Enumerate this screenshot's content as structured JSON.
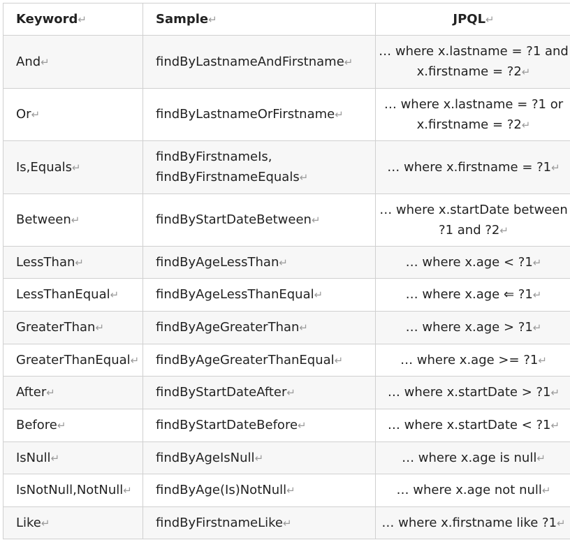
{
  "table": {
    "headers": {
      "keyword": "Keyword",
      "sample": "Sample",
      "jpql": "JPQL"
    },
    "paragraph_mark": "↵",
    "rows": [
      {
        "keyword": "And",
        "sample": "findByLastnameAndFirstname",
        "sample2": "",
        "jpql": "… where x.lastname = ?1 and x.firstname = ?2"
      },
      {
        "keyword": "Or",
        "sample": "findByLastnameOrFirstname",
        "sample2": "",
        "jpql": "… where x.lastname = ?1 or x.firstname = ?2"
      },
      {
        "keyword": "Is,Equals",
        "sample": "findByFirstnameIs,",
        "sample2": "findByFirstnameEquals",
        "jpql": "… where x.firstname = ?1"
      },
      {
        "keyword": "Between",
        "sample": "findByStartDateBetween",
        "sample2": "",
        "jpql": "… where x.startDate between ?1 and ?2"
      },
      {
        "keyword": "LessThan",
        "sample": "findByAgeLessThan",
        "sample2": "",
        "jpql": "… where x.age < ?1"
      },
      {
        "keyword": "LessThanEqual",
        "sample": "findByAgeLessThanEqual",
        "sample2": "",
        "jpql": "… where x.age ⇐ ?1"
      },
      {
        "keyword": "GreaterThan",
        "sample": "findByAgeGreaterThan",
        "sample2": "",
        "jpql": "… where x.age > ?1"
      },
      {
        "keyword": "GreaterThanEqual",
        "sample": "findByAgeGreaterThanEqual",
        "sample2": "",
        "jpql": "… where x.age >= ?1"
      },
      {
        "keyword": "After",
        "sample": "findByStartDateAfter",
        "sample2": "",
        "jpql": "… where x.startDate > ?1"
      },
      {
        "keyword": "Before",
        "sample": "findByStartDateBefore",
        "sample2": "",
        "jpql": "… where x.startDate < ?1"
      },
      {
        "keyword": "IsNull",
        "sample": "findByAgeIsNull",
        "sample2": "",
        "jpql": "… where x.age is null"
      },
      {
        "keyword": "IsNotNull,NotNull",
        "sample": "findByAge(Is)NotNull",
        "sample2": "",
        "jpql": "… where x.age not null"
      },
      {
        "keyword": "Like",
        "sample": "findByFirstnameLike",
        "sample2": "",
        "jpql": "… where x.firstname like ?1"
      }
    ]
  }
}
